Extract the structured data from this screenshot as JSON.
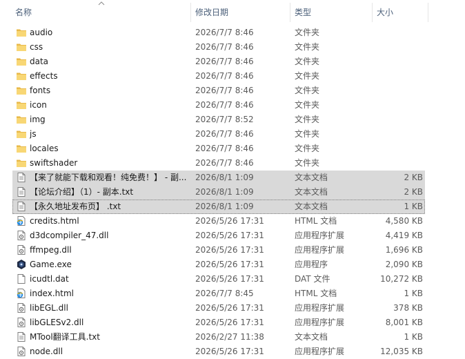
{
  "columns": {
    "name": "名称",
    "date": "修改日期",
    "type": "类型",
    "size": "大小"
  },
  "files": [
    {
      "name": "audio",
      "date": "2026/7/7 8:46",
      "type": "文件夹",
      "size": "",
      "icon": "folder-icon"
    },
    {
      "name": "css",
      "date": "2026/7/7 8:46",
      "type": "文件夹",
      "size": "",
      "icon": "folder-icon"
    },
    {
      "name": "data",
      "date": "2026/7/7 8:46",
      "type": "文件夹",
      "size": "",
      "icon": "folder-icon"
    },
    {
      "name": "effects",
      "date": "2026/7/7 8:46",
      "type": "文件夹",
      "size": "",
      "icon": "folder-icon"
    },
    {
      "name": "fonts",
      "date": "2026/7/7 8:46",
      "type": "文件夹",
      "size": "",
      "icon": "folder-icon"
    },
    {
      "name": "icon",
      "date": "2026/7/7 8:46",
      "type": "文件夹",
      "size": "",
      "icon": "folder-icon"
    },
    {
      "name": "img",
      "date": "2026/7/7 8:52",
      "type": "文件夹",
      "size": "",
      "icon": "folder-icon"
    },
    {
      "name": "js",
      "date": "2026/7/7 8:46",
      "type": "文件夹",
      "size": "",
      "icon": "folder-icon"
    },
    {
      "name": "locales",
      "date": "2026/7/7 8:46",
      "type": "文件夹",
      "size": "",
      "icon": "folder-icon"
    },
    {
      "name": "swiftshader",
      "date": "2026/7/7 8:46",
      "type": "文件夹",
      "size": "",
      "icon": "folder-icon"
    },
    {
      "name": "【来了就能下载和观看！纯免费！】 - 副...",
      "date": "2026/8/1 1:09",
      "type": "文本文档",
      "size": "2 KB",
      "icon": "text-file-icon",
      "selected": true
    },
    {
      "name": "【论坛介绍】（1）- 副本.txt",
      "date": "2026/8/1 1:09",
      "type": "文本文档",
      "size": "2 KB",
      "icon": "text-file-icon",
      "selected": true
    },
    {
      "name": "【永久地址发布页】 .txt",
      "date": "2026/8/1 1:09",
      "type": "文本文档",
      "size": "1 KB",
      "icon": "text-file-icon",
      "selected": true,
      "focus": true
    },
    {
      "name": "credits.html",
      "date": "2026/5/26 17:31",
      "type": "HTML 文档",
      "size": "4,580 KB",
      "icon": "html-file-icon"
    },
    {
      "name": "d3dcompiler_47.dll",
      "date": "2026/5/26 17:31",
      "type": "应用程序扩展",
      "size": "4,419 KB",
      "icon": "dll-file-icon"
    },
    {
      "name": "ffmpeg.dll",
      "date": "2026/5/26 17:31",
      "type": "应用程序扩展",
      "size": "1,696 KB",
      "icon": "dll-file-icon"
    },
    {
      "name": "Game.exe",
      "date": "2026/5/26 17:31",
      "type": "应用程序",
      "size": "2,090 KB",
      "icon": "game-exe-icon"
    },
    {
      "name": "icudtl.dat",
      "date": "2026/5/26 17:31",
      "type": "DAT 文件",
      "size": "10,272 KB",
      "icon": "blank-file-icon"
    },
    {
      "name": "index.html",
      "date": "2026/7/7 8:45",
      "type": "HTML 文档",
      "size": "1 KB",
      "icon": "html-file-icon"
    },
    {
      "name": "libEGL.dll",
      "date": "2026/5/26 17:31",
      "type": "应用程序扩展",
      "size": "378 KB",
      "icon": "dll-file-icon"
    },
    {
      "name": "libGLESv2.dll",
      "date": "2026/5/26 17:31",
      "type": "应用程序扩展",
      "size": "8,001 KB",
      "icon": "dll-file-icon"
    },
    {
      "name": "MTool翻译工具.txt",
      "date": "2026/2/27 11:38",
      "type": "文本文档",
      "size": "1 KB",
      "icon": "text-file-icon"
    },
    {
      "name": "node.dll",
      "date": "2026/5/26 17:31",
      "type": "应用程序扩展",
      "size": "12,035 KB",
      "icon": "dll-file-icon"
    }
  ],
  "colors": {
    "folder": "#f8d775",
    "selected_row": "#d9d9d9",
    "header_text": "#4c607a"
  }
}
